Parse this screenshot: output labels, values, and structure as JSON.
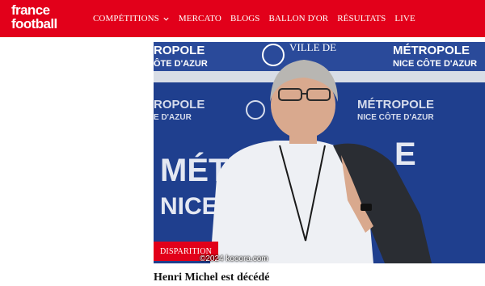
{
  "header": {
    "logo_line1": "france",
    "logo_line2": "football",
    "nav": [
      {
        "label": "COMPÉTITIONS",
        "has_dropdown": true
      },
      {
        "label": "MERCATO"
      },
      {
        "label": "BLOGS"
      },
      {
        "label": "BALLON D'OR"
      },
      {
        "label": "RÉSULTATS"
      },
      {
        "label": "LIVE"
      }
    ]
  },
  "article": {
    "tag": "DISPARITION",
    "credit": "©2024 kooora.com",
    "headline": "Henri Michel est décédé",
    "photo_signage": {
      "top_left": "ROPOLE",
      "top_left_sub": "ÔTE D'AZUR",
      "top_mid": "VILLE DE",
      "top_right": "MÉTROPOLE",
      "top_right_sub": "NICE CÔTE D'AZUR",
      "mid_left": "ROPOLE",
      "mid_left_sub": "E D'AZUR",
      "mid_right": "MÉTROPOLE",
      "mid_right_sub": "NICE CÔTE D'AZUR",
      "big_left": "MÉT",
      "big_left2": "NICE",
      "big_right": "E"
    }
  },
  "colors": {
    "brand_red": "#e2001a",
    "signage_blue": "#1f3f8e"
  }
}
